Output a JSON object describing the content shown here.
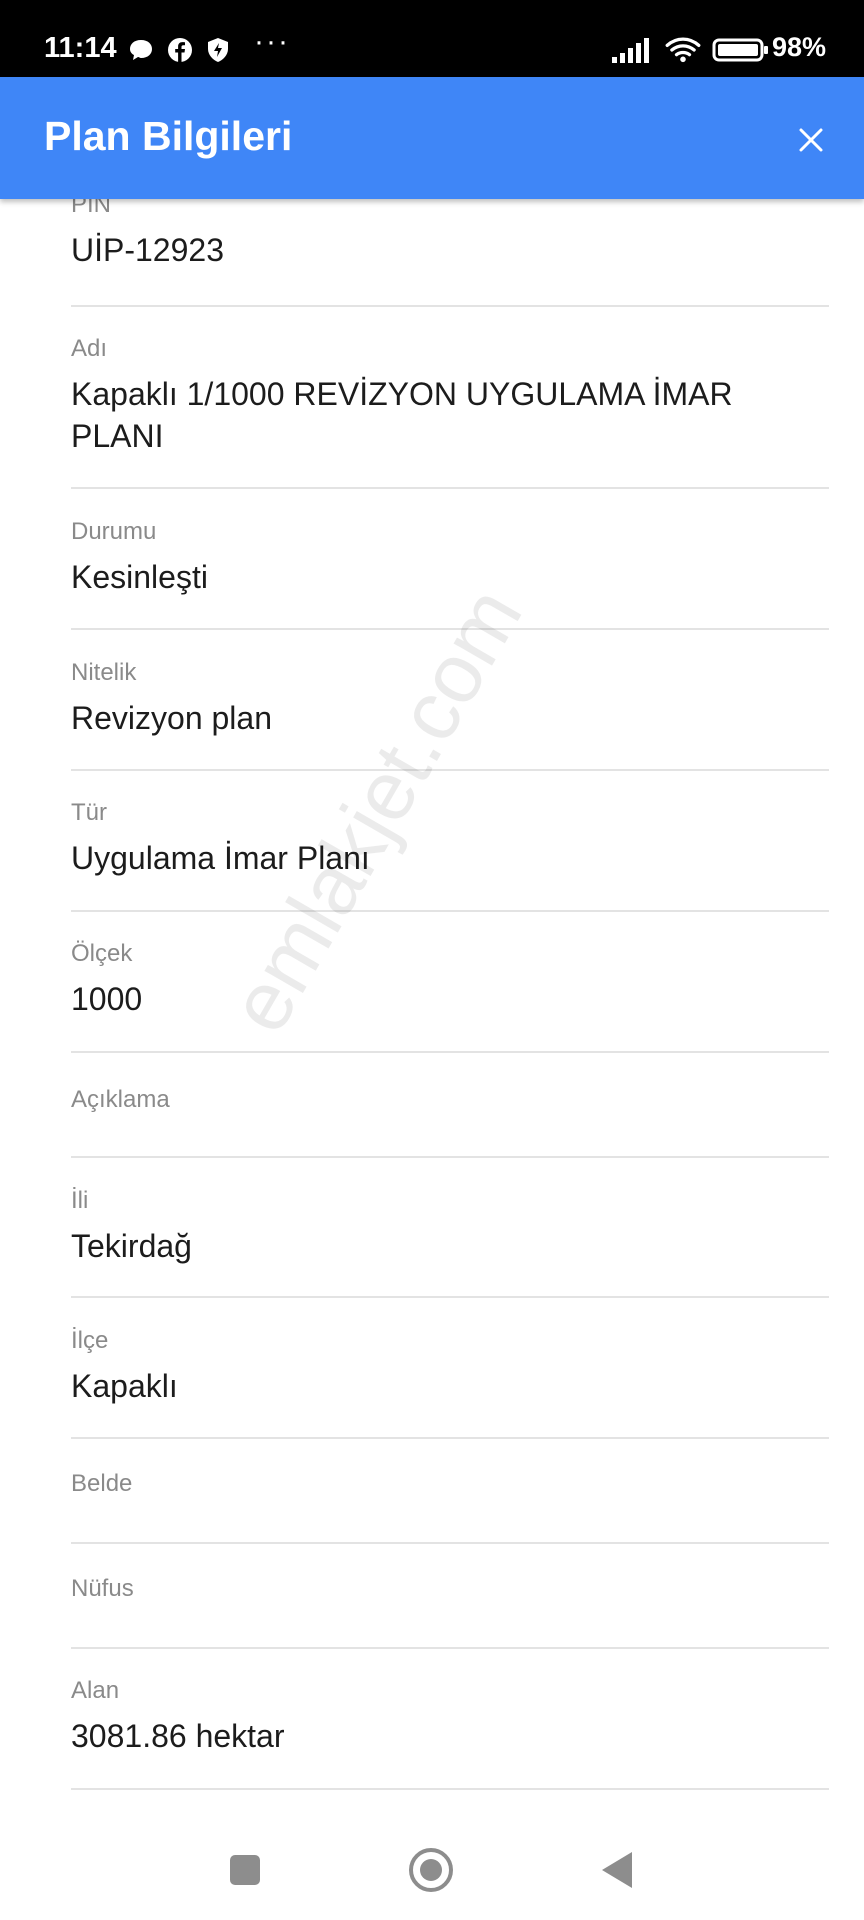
{
  "status_bar": {
    "time": "11:14",
    "battery": "98%",
    "more": "···",
    "icons": [
      "chat-bubble-icon",
      "facebook-icon",
      "shield-icon",
      "signal-icon",
      "wifi-icon",
      "battery-icon"
    ]
  },
  "app_bar": {
    "title": "Plan Bilgileri",
    "background_color": "#3f86f7",
    "close_icon": "close-icon"
  },
  "fields": [
    {
      "label": "PIN",
      "value": "UİP-12923"
    },
    {
      "label": "Adı",
      "value": "Kapaklı 1/1000 REVİZYON UYGULAMA İMAR PLANI"
    },
    {
      "label": "Durumu",
      "value": "Kesinleşti"
    },
    {
      "label": "Nitelik",
      "value": "Revizyon plan"
    },
    {
      "label": "Tür",
      "value": "Uygulama İmar Planı"
    },
    {
      "label": "Ölçek",
      "value": "1000"
    },
    {
      "label": "Açıklama",
      "value": ""
    },
    {
      "label": "İli",
      "value": "Tekirdağ"
    },
    {
      "label": "İlçe",
      "value": "Kapaklı"
    },
    {
      "label": "Belde",
      "value": ""
    },
    {
      "label": "Nüfus",
      "value": ""
    },
    {
      "label": "Alan",
      "value": "3081.86 hektar"
    }
  ],
  "watermark": "emlakjet.com",
  "nav_bar": {
    "buttons": [
      "recents-button",
      "home-button",
      "back-button"
    ]
  }
}
